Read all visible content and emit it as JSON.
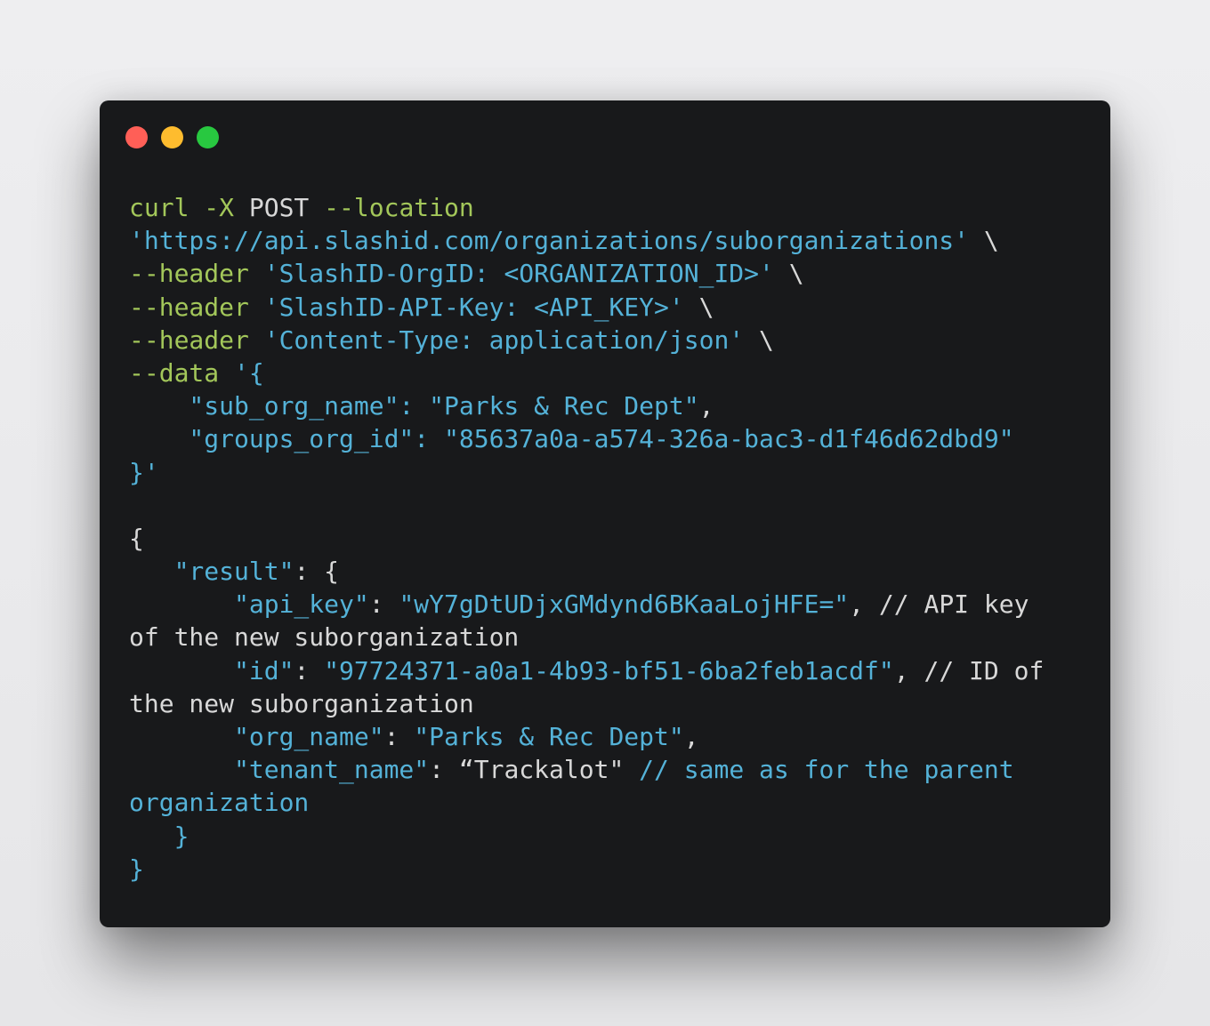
{
  "window": {
    "controls": [
      {
        "name": "close",
        "color": "#ff5f57"
      },
      {
        "name": "minimize",
        "color": "#febc2e"
      },
      {
        "name": "maximize",
        "color": "#28c840"
      }
    ]
  },
  "colors": {
    "background": "#18191b",
    "command": "#a3c75a",
    "string": "#54b2d8",
    "plain": "#d8d8d8"
  },
  "code_lines": [
    [
      {
        "t": "curl -X ",
        "c": "g"
      },
      {
        "t": "POST ",
        "c": "w"
      },
      {
        "t": "--location",
        "c": "g"
      }
    ],
    [
      {
        "t": "'https://api.slashid.com/organizations/suborganizations'",
        "c": "b"
      },
      {
        "t": " \\",
        "c": "w"
      }
    ],
    [
      {
        "t": "--header ",
        "c": "g"
      },
      {
        "t": "'SlashID-OrgID: <ORGANIZATION_ID>'",
        "c": "b"
      },
      {
        "t": " \\",
        "c": "w"
      }
    ],
    [
      {
        "t": "--header ",
        "c": "g"
      },
      {
        "t": "'SlashID-API-Key: <API_KEY>'",
        "c": "b"
      },
      {
        "t": " \\",
        "c": "w"
      }
    ],
    [
      {
        "t": "--header ",
        "c": "g"
      },
      {
        "t": "'Content-Type: application/json'",
        "c": "b"
      },
      {
        "t": " \\",
        "c": "w"
      }
    ],
    [
      {
        "t": "--data ",
        "c": "g"
      },
      {
        "t": "'{",
        "c": "b"
      }
    ],
    [
      {
        "t": "    \"sub_org_name\": \"Parks & Rec Dept\"",
        "c": "b"
      },
      {
        "t": ",",
        "c": "w"
      }
    ],
    [
      {
        "t": "    \"groups_org_id\": \"85637a0a-a574-326a-bac3-d1f46d62dbd9\"",
        "c": "b"
      }
    ],
    [
      {
        "t": "}'",
        "c": "b"
      }
    ],
    [
      {
        "t": "",
        "c": "w"
      }
    ],
    [
      {
        "t": "{",
        "c": "w"
      }
    ],
    [
      {
        "t": "   \"result\"",
        "c": "b"
      },
      {
        "t": ": {",
        "c": "w"
      }
    ],
    [
      {
        "t": "       \"api_key\"",
        "c": "b"
      },
      {
        "t": ": ",
        "c": "w"
      },
      {
        "t": "\"wY7gDtUDjxGMdynd6BKaaLojHFE=\"",
        "c": "b"
      },
      {
        "t": ", // API key",
        "c": "w"
      }
    ],
    [
      {
        "t": "of the new suborganization",
        "c": "w"
      }
    ],
    [
      {
        "t": "       \"id\"",
        "c": "b"
      },
      {
        "t": ": ",
        "c": "w"
      },
      {
        "t": "\"97724371-a0a1-4b93-bf51-6ba2feb1acdf\"",
        "c": "b"
      },
      {
        "t": ", // ID of",
        "c": "w"
      }
    ],
    [
      {
        "t": "the new suborganization",
        "c": "w"
      }
    ],
    [
      {
        "t": "       \"org_name\"",
        "c": "b"
      },
      {
        "t": ": ",
        "c": "w"
      },
      {
        "t": "\"Parks & Rec Dept\"",
        "c": "b"
      },
      {
        "t": ",",
        "c": "w"
      }
    ],
    [
      {
        "t": "       \"tenant_name\"",
        "c": "b"
      },
      {
        "t": ": “Trackalot\" ",
        "c": "w"
      },
      {
        "t": "// same as for the parent",
        "c": "b"
      }
    ],
    [
      {
        "t": "organization",
        "c": "b"
      }
    ],
    [
      {
        "t": "   }",
        "c": "b"
      }
    ],
    [
      {
        "t": "}",
        "c": "b"
      }
    ]
  ]
}
